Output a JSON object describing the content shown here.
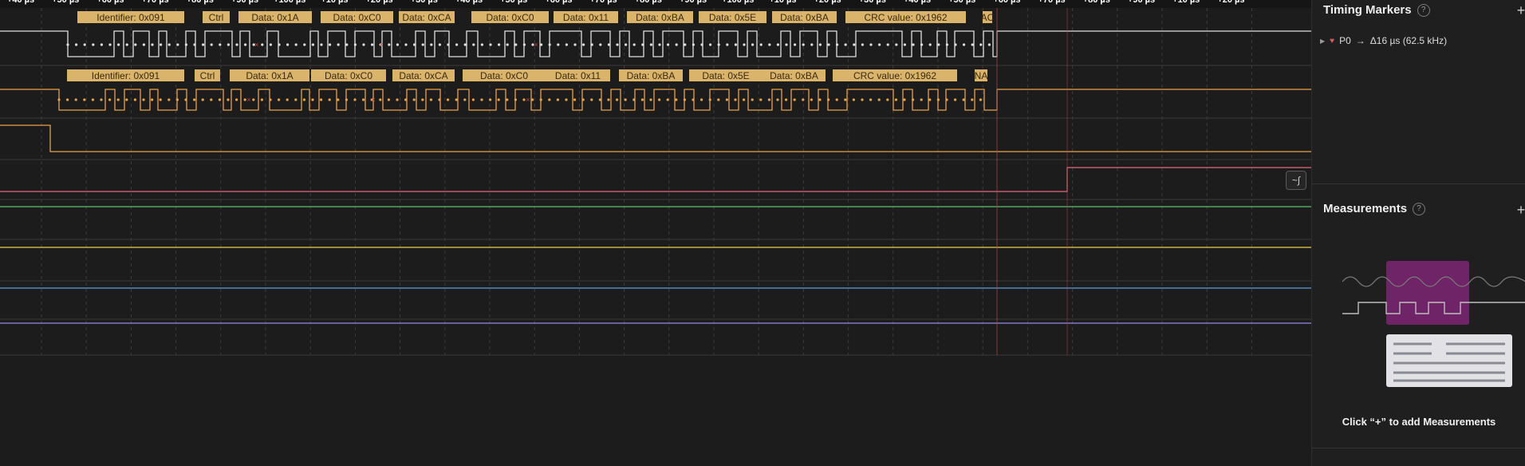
{
  "ruler": {
    "labels": [
      "+40 µs",
      "+50 µs",
      "+60 µs",
      "+70 µs",
      "+80 µs",
      "+90 µs",
      "+100 µs",
      "+10 µs",
      "+20 µs",
      "+30 µs",
      "+40 µs",
      "+50 µs",
      "+60 µs",
      "+70 µs",
      "+80 µs",
      "+90 µs",
      "+100 µs",
      "+10 µs",
      "+20 µs",
      "+30 µs",
      "+40 µs",
      "+50 µs",
      "+60 µs",
      "+70 µs",
      "+80 µs",
      "+90 µs",
      "+10 µs",
      "+20 µs"
    ]
  },
  "channel0": {
    "frames": [
      "Identifier: 0x091",
      "Ctrl",
      "Data: 0x1A",
      "Data: 0xC0",
      "Data: 0xCA",
      "Data: 0xC0",
      "Data: 0x11",
      "Data: 0xBA",
      "Data: 0x5E",
      "Data: 0xBA",
      "CRC value: 0x1962",
      "AC"
    ]
  },
  "channel1": {
    "frames": [
      "Identifier: 0x091",
      "Ctrl",
      "Data: 0x1A",
      "Data: 0xC0",
      "Data: 0xCA",
      "Data: 0xC0",
      "Data: 0x11",
      "Data: 0xBA",
      "Data: 0x5E",
      "Data: 0xBA",
      "CRC value: 0x1962",
      "NA"
    ]
  },
  "colors": {
    "background": "#1c1c1c",
    "frame_fill": "#d9b46a",
    "channel0": "#e0e0e0",
    "channel1": "#e8a24a",
    "channel2": "#e8a24a",
    "channel3": "#e56a7a",
    "channel4": "#5cbf6e",
    "channel5": "#e8d04a",
    "channel6": "#5aa0e6",
    "channel7": "#9a8ae6",
    "marker": "#c0404a"
  },
  "wave_toggle": {
    "icon": "waveform-icon",
    "glyph": "~∫"
  },
  "timing_markers": {
    "title": "Timing Markers",
    "marker": {
      "name": "P0",
      "arrow": "→",
      "delta": "Δ16 µs (62.5 kHz)"
    }
  },
  "measurements": {
    "title": "Measurements",
    "hint": "Click “+” to add Measurements"
  }
}
